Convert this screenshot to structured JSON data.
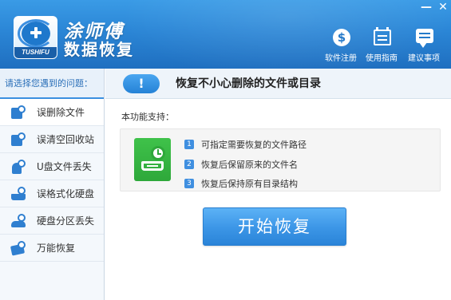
{
  "window": {
    "brand_name": "涂师傅",
    "product_name": "数据恢复",
    "logo_tag": "TUSHIFU",
    "minimize_glyph": "—",
    "close_glyph": "✕"
  },
  "toolbar": {
    "items": [
      {
        "label": "软件注册",
        "icon": "money-icon"
      },
      {
        "label": "使用指南",
        "icon": "guide-icon"
      },
      {
        "label": "建议事项",
        "icon": "suggestion-icon"
      }
    ]
  },
  "sidebar": {
    "header": "请选择您遇到的问题：",
    "items": [
      {
        "label": "误删除文件",
        "active": true
      },
      {
        "label": "误清空回收站",
        "active": false
      },
      {
        "label": "U盘文件丢失",
        "active": false
      },
      {
        "label": "误格式化硬盘",
        "active": false
      },
      {
        "label": "硬盘分区丢失",
        "active": false
      },
      {
        "label": "万能恢复",
        "active": false
      }
    ]
  },
  "main": {
    "alert_glyph": "!",
    "title": "恢复不小心删除的文件或目录",
    "support_label": "本功能支持：",
    "features": [
      {
        "num": "1",
        "text": "可指定需要恢复的文件路径"
      },
      {
        "num": "2",
        "text": "恢复后保留原来的文件名"
      },
      {
        "num": "3",
        "text": "恢复后保持原有目录结构"
      }
    ],
    "start_button": "开始恢复"
  },
  "colors": {
    "header_blue": "#2b86d6",
    "accent_blue": "#3a8fe0",
    "feature_green": "#2ea83a"
  }
}
